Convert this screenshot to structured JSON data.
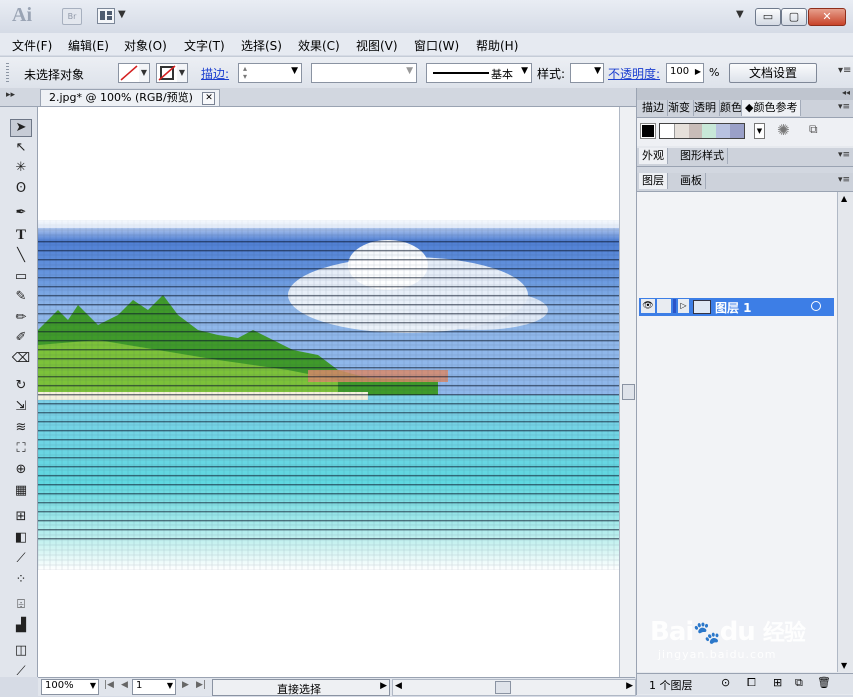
{
  "title_bar": {
    "app_logo": "Ai",
    "bridge_button": "Br",
    "window_controls": {
      "minimize": "▭",
      "maximize": "▢",
      "close": "✕"
    }
  },
  "menu": [
    "文件(F)",
    "编辑(E)",
    "对象(O)",
    "文字(T)",
    "选择(S)",
    "效果(C)",
    "视图(V)",
    "窗口(W)",
    "帮助(H)"
  ],
  "control_bar": {
    "selection_status": "未选择对象",
    "stroke_label": "描边:",
    "stroke_profile": "基本",
    "style_label": "样式:",
    "opacity_label": "不透明度:",
    "opacity_value": "100",
    "opacity_unit": "%",
    "doc_setup_button": "文档设置"
  },
  "document_tab": {
    "title": "2.jpg* @ 100% (RGB/预览)",
    "close": "✕"
  },
  "status_bar": {
    "zoom": "100%",
    "artboard_number": "1",
    "current_tool": "直接选择"
  },
  "panels": {
    "top_tabs": [
      "描边",
      "渐变",
      "透明",
      "颜色",
      "颜色参考"
    ],
    "top_active": "颜色参考",
    "color_guide_swatches": [
      "#ffffff",
      "#e6e0da",
      "#c8bcb8",
      "#c8e8d8",
      "#b8c2e0",
      "#9aa0c8"
    ],
    "mid_tabs": [
      "外观",
      "图形样式"
    ],
    "mid_active": "外观",
    "layer_tabs": [
      "图层",
      "画板"
    ],
    "layer_active": "图层",
    "layer_name": "图层 1",
    "layer_count": "1 个图层"
  },
  "watermark": {
    "brand": "Bai",
    "brand_suffix": "du",
    "jingyan": "经验",
    "url": "jingyan.baidu.com"
  }
}
